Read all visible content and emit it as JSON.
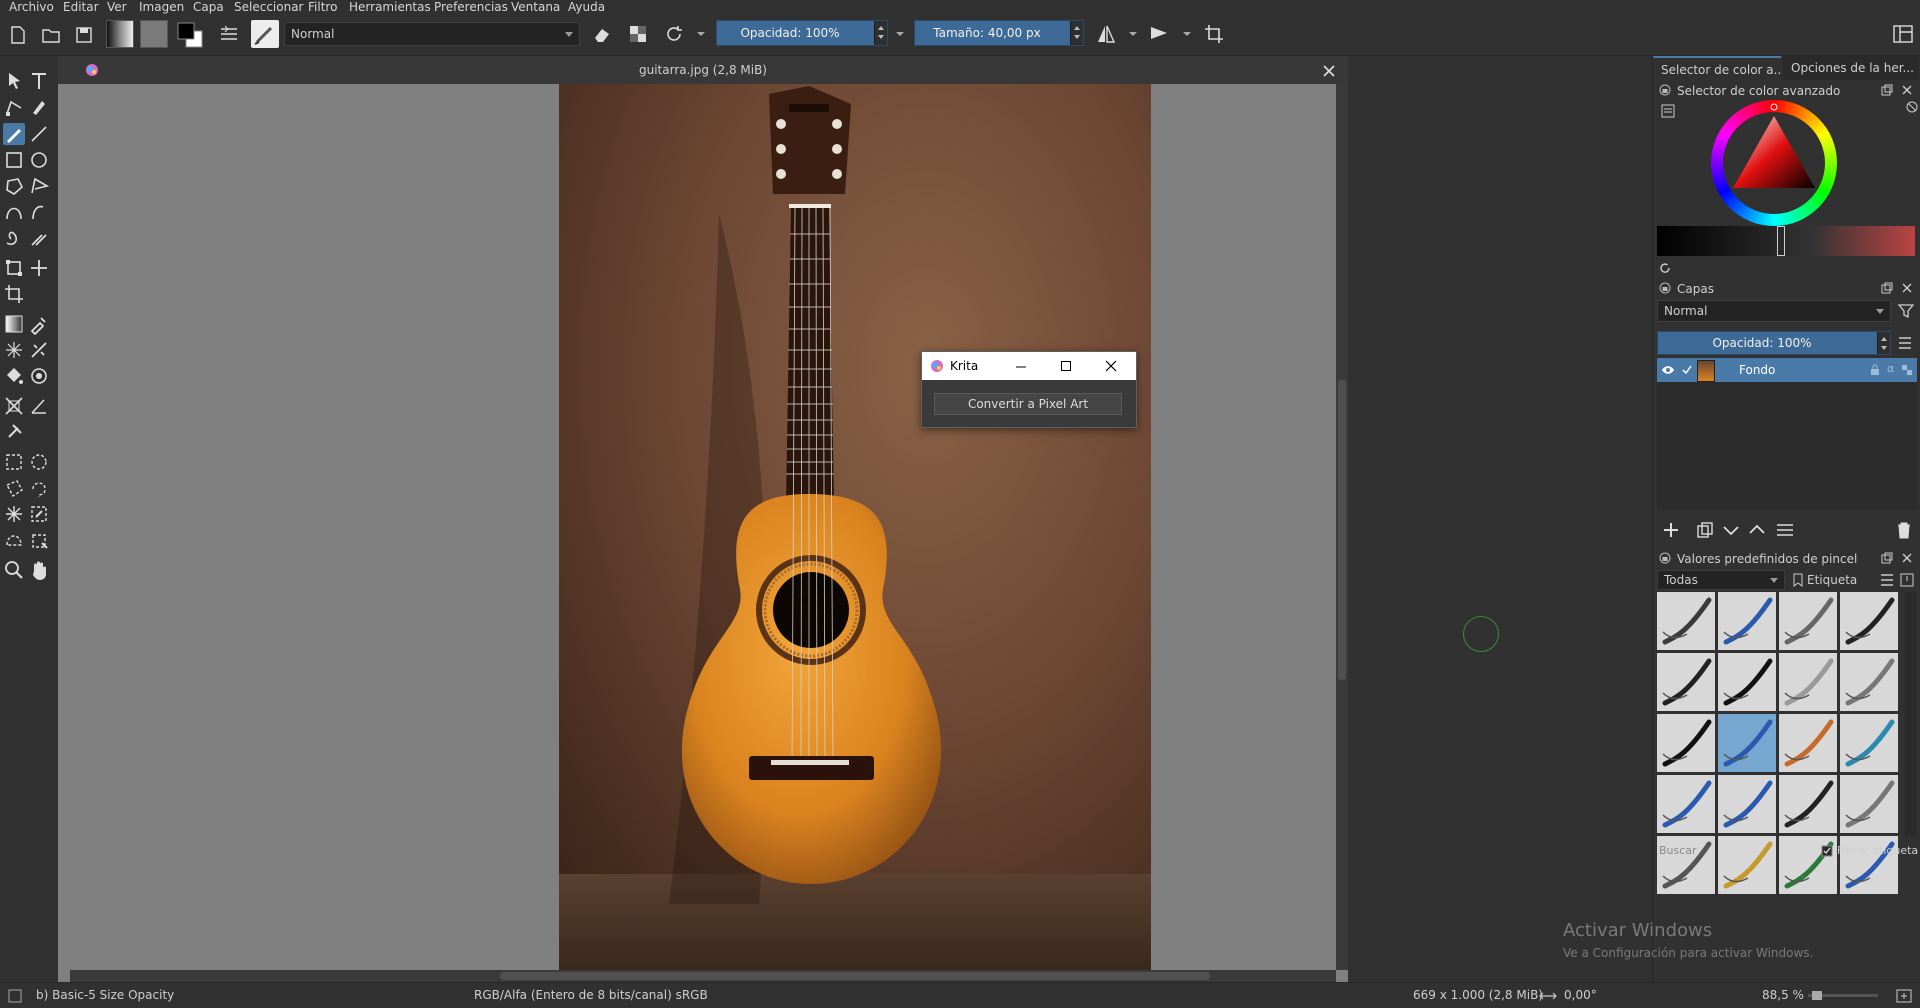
{
  "menu": [
    "Archivo",
    "Editar",
    "Ver",
    "Imagen",
    "Capa",
    "Seleccionar",
    "Filtro",
    "Herramientas",
    "Preferencias",
    "Ventana",
    "Ayuda"
  ],
  "toolbar": {
    "blend_mode": "Normal",
    "opacity_label": "Opacidad: 100%",
    "size_label": "Tamaño: 40,00 px"
  },
  "document": {
    "title": "guitarra.jpg (2,8 MiB)"
  },
  "dock": {
    "tab_color": "Selector de color a...",
    "tab_tools": "Opciones de la her...",
    "color_panel_title": "Selector de color avanzado",
    "layers_title": "Capas",
    "layers_blend": "Normal",
    "layers_opacity": "Opacidad:  100%",
    "layer_name": "Fondo",
    "presets_title": "Valores predefinidos de pincel",
    "presets_filter": "Todas",
    "presets_tag": "Etiqueta",
    "presets_search": "Buscar",
    "presets_filter_tag": "Filtrar etiqueta"
  },
  "dialog": {
    "title": "Krita",
    "button": "Convertir a Pixel Art"
  },
  "watermark": {
    "line1": "Activar Windows",
    "line2": "Ve a Configuración para activar Windows."
  },
  "status": {
    "brush": "b) Basic-5 Size Opacity",
    "color_model": "RGB/Alfa (Entero de 8 bits/canal)  sRGB",
    "dimensions": "669 x 1.000 (2,8 MiB)",
    "rotation": "0,00°",
    "zoom": "88,5 %"
  },
  "colors": {
    "accent": "#4a7ba8",
    "panel_bg": "#313131",
    "canvas_bg": "#808080"
  }
}
